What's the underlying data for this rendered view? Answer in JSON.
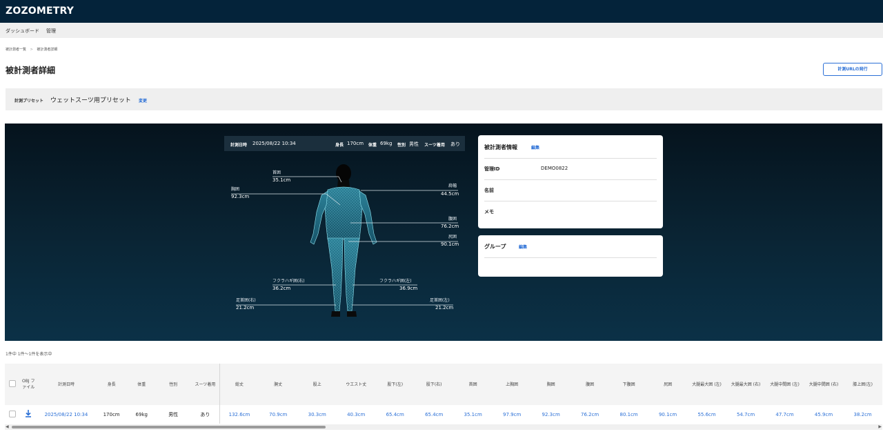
{
  "app": {
    "logo": "ZOZOMETRY"
  },
  "nav": {
    "items": [
      {
        "label": "ダッシュボード"
      },
      {
        "label": "管理"
      }
    ]
  },
  "breadcrumb": {
    "items": [
      "被計測者一覧",
      "被計測者詳細"
    ],
    "separator": ">"
  },
  "page": {
    "title": "被計測者詳細",
    "issue_url_button": "計測URLの発行"
  },
  "preset": {
    "label": "計測プリセット",
    "name": "ウェットスーツ用プリセット",
    "change_link": "変更"
  },
  "measurement_info": {
    "date_label": "計測日時",
    "date_value": "2025/08/22 10:34",
    "height_label": "身長",
    "height_value": "170cm",
    "weight_label": "体重",
    "weight_value": "69kg",
    "sex_label": "性別",
    "sex_value": "男性",
    "suit_label": "スーツ着用",
    "suit_value": "あり"
  },
  "body_measurements": {
    "neck": {
      "label": "首囲",
      "value": "35.1cm"
    },
    "chest": {
      "label": "胸囲",
      "value": "92.3cm"
    },
    "shoulder": {
      "label": "肩幅",
      "value": "44.5cm"
    },
    "waist": {
      "label": "腹囲",
      "value": "76.2cm"
    },
    "hip": {
      "label": "尻囲",
      "value": "90.1cm"
    },
    "calf_right": {
      "label": "フクラハギ囲(右)",
      "value": "36.2cm"
    },
    "calf_left": {
      "label": "フクラハギ囲(左)",
      "value": "36.9cm"
    },
    "ankle_right": {
      "label": "足首囲(右)",
      "value": "21.2cm"
    },
    "ankle_left": {
      "label": "足首囲(左)",
      "value": "21.2cm"
    }
  },
  "subject_card": {
    "title": "被計測者情報",
    "edit": "編集",
    "rows": [
      {
        "label": "管理ID",
        "value": "DEMO0822"
      },
      {
        "label": "名前",
        "value": ""
      },
      {
        "label": "メモ",
        "value": ""
      }
    ]
  },
  "group_card": {
    "title": "グループ",
    "edit": "編集"
  },
  "table": {
    "count_text": "1件中 1件～1件を表示中",
    "headers": [
      "",
      "OBJ ファイル",
      "計測日時",
      "身長",
      "体重",
      "性別",
      "スーツ着用",
      "総丈",
      "胴丈",
      "股上",
      "ウエスト丈",
      "股下(左)",
      "股下(右)",
      "首囲",
      "上胸囲",
      "胸囲",
      "腹囲",
      "下腹囲",
      "尻囲",
      "大腿最大囲 (左)",
      "大腿最大囲 (右)",
      "大腿中間囲 (左)",
      "大腿中間囲 (右)",
      "膝上囲(左)"
    ],
    "rows": [
      {
        "cells": [
          "",
          "",
          "2025/08/22 10:34",
          "170cm",
          "69kg",
          "男性",
          "あり",
          "132.6cm",
          "70.9cm",
          "30.3cm",
          "40.3cm",
          "65.4cm",
          "65.4cm",
          "35.1cm",
          "97.9cm",
          "92.3cm",
          "76.2cm",
          "80.1cm",
          "90.1cm",
          "55.6cm",
          "54.7cm",
          "47.7cm",
          "45.9cm",
          "38.2cm"
        ]
      }
    ]
  },
  "colors": {
    "brand_dark": "#04233a",
    "link": "#2a6fd6"
  },
  "icons": {
    "download": "download-icon"
  }
}
